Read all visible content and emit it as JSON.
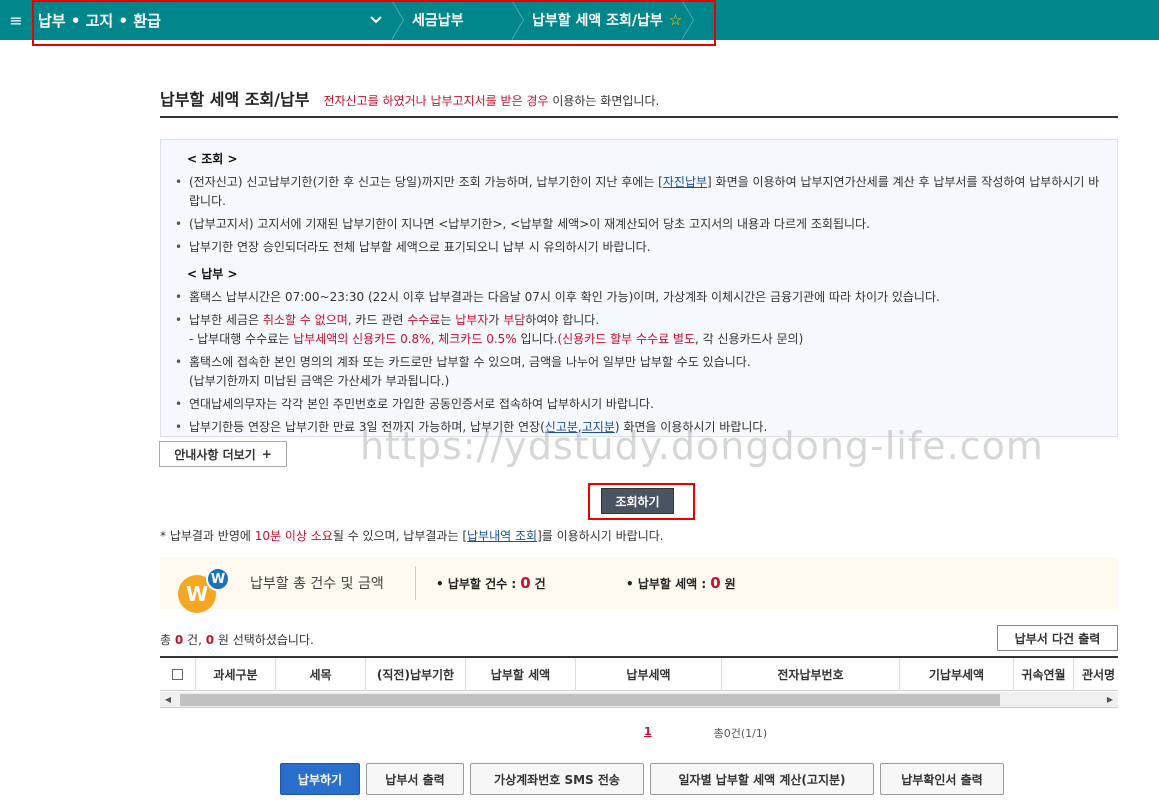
{
  "nav": {
    "menu_icon": "≡",
    "crumb_main": "납부 • 고지 • 환급",
    "crumb_2": "세금납부",
    "crumb_3": "납부할 세액 조회/납부",
    "star": "☆"
  },
  "page": {
    "title": "납부할 세액 조회/납부",
    "subtitle_red": "전자신고를 하였거나 납부고지서를 받은 경우",
    "subtitle_rest": " 이용하는 화면입니다."
  },
  "info": {
    "section1_title": "< 조회 >",
    "s1_item1_a": "(전자신고) 신고납부기한(기한 후 신고는 당일)까지만 조회 가능하며, 납부기한이 지난 후에는 [",
    "s1_item1_link": "자진납부",
    "s1_item1_b": "] 화면을 이용하여 납부지연가산세를 계산 후 납부서를 작성하여 납부하시기 바랍니다.",
    "s1_item2": "(납부고지서) 고지서에 기재된 납부기한이 지나면 <납부기한>, <납부할 세액>이 재계산되어 당초 고지서의 내용과 다르게 조회됩니다.",
    "s1_item3": "납부기한 연장 승인되더라도 전체 납부할 세액으로 표기되오니 납부 시 유의하시기 바랍니다.",
    "section2_title": "< 납부 >",
    "s2_item1": "홈택스 납부시간은 07:00~23:30 (22시 이후 납부결과는 다음날 07시 이후 확인 가능)이며, 가상계좌 이체시간은 금융기관에 따라 차이가 있습니다.",
    "s2_item2_a": "납부한 세금은 ",
    "s2_item2_red1": "취소할 수 없으며,",
    "s2_item2_b": " 카드 관련 ",
    "s2_item2_red2": "수수료",
    "s2_item2_c": "는 ",
    "s2_item2_red3": "납부자",
    "s2_item2_d": "가 ",
    "s2_item2_red4": "부담",
    "s2_item2_e": "하여야 합니다.",
    "s2_item2_sub_a": "- 납부대행 수수료는 ",
    "s2_item2_sub_red1": "납부세액의 신용카드 0.8%, 체크카드 0.5%",
    "s2_item2_sub_b": " 입니다.",
    "s2_item2_sub_red2": "(신용카드 할부 수수료 별도",
    "s2_item2_sub_c": ", 각 신용카드사 문의)",
    "s2_item3": "홈택스에 접속한 본인 명의의 계좌 또는 카드로만 납부할 수 있으며, 금액을 나누어 일부만 납부할 수도 있습니다.",
    "s2_item3_sub": "(납부기한까지 미납된 금액은 가산세가 부과됩니다.)",
    "s2_item4": "연대납세의무자는 각각 본인 주민번호로 가입한 공동인증서로 접속하여 납부하시기 바랍니다.",
    "s2_item5_a": "납부기한등 연장은 납부기한 만료 3일 전까지 가능하며, 납부기한 연장(",
    "s2_item5_link1": "신고분",
    "s2_item5_comma": ",",
    "s2_item5_link2": "고지분",
    "s2_item5_b": ") 화면을 이용하시기 바랍니다."
  },
  "more_button": "안내사항 더보기",
  "more_plus": "+",
  "watermark": "https://ydstudy.dongdong-life.com",
  "query_button": "조회하기",
  "note": {
    "a": "* 납부결과 반영에 ",
    "red": "10분 이상 소요",
    "b": "될 수 있으며, 납부결과는 [",
    "link": "납부내역 조회",
    "c": "]를 이용하시기 바랍니다."
  },
  "summary": {
    "logo_big": "W",
    "logo_small": "W",
    "label": "납부할 총 건수 및 금액",
    "count_label": "• 납부할 건수 :",
    "count_value": "0",
    "count_unit": "건",
    "amount_label": "• 납부할 세액 :",
    "amount_value": "0",
    "amount_unit": "원"
  },
  "total": {
    "a": "총 ",
    "count": "0",
    "b": " 건, ",
    "amount": "0",
    "c": " 원 선택하셨습니다."
  },
  "print_multi": "납부서 다건 출력",
  "table": {
    "columns": [
      "과세구분",
      "세목",
      "(직전)납부기한",
      "납부할 세액",
      "납부세액",
      "전자납부번호",
      "기납부세액",
      "귀속연월",
      "관서명"
    ]
  },
  "pager": {
    "current": "1",
    "count": "총0건(1/1)"
  },
  "buttons": {
    "pay": "납부하기",
    "print": "납부서 출력",
    "sms": "가상계좌번호 SMS 전송",
    "daily": "일자별 납부할 세액 계산(고지분)",
    "confirm": "납부확인서 출력"
  }
}
